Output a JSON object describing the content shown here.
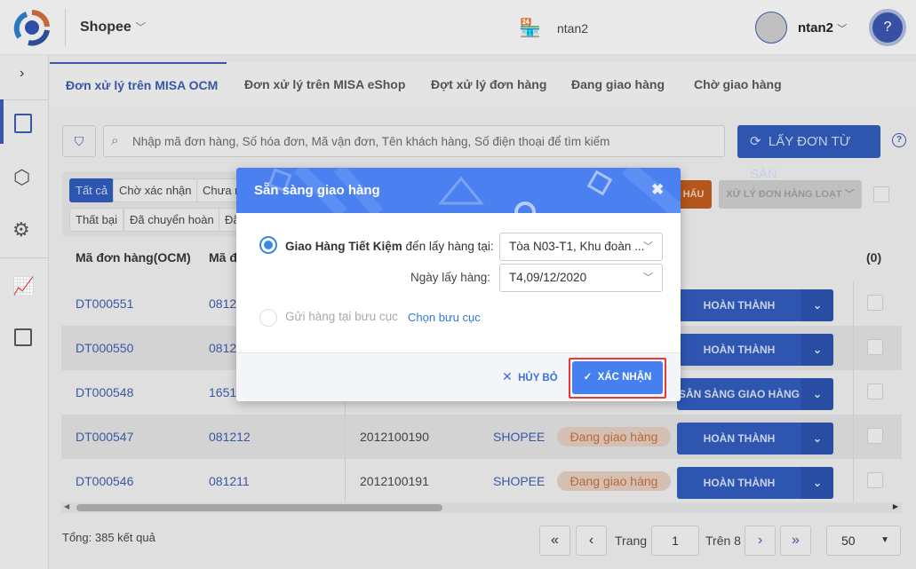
{
  "header": {
    "store": "Shopee",
    "shop_name": "ntan2",
    "user_name": "ntan2"
  },
  "tabs": [
    "Đơn xử lý trên MISA OCM",
    "Đơn xử lý trên MISA eShop",
    "Đợt xử lý đơn hàng",
    "Đang giao hàng",
    "Chờ giao hàng"
  ],
  "search": {
    "placeholder": "Nhập mã đơn hàng, Số hóa đơn, Mã vận đơn, Tên khách hàng, Số điện thoại để tìm kiếm",
    "fetch_button": "LẤY ĐƠN TỪ SÀN"
  },
  "chips": [
    "Tất cả",
    "Chờ xác nhận",
    "Chưa n",
    "Thất bại",
    "Đã chuyển hoàn",
    "Đã"
  ],
  "toolbar": {
    "orange_button": "HẤU",
    "bulk_button": "XỬ LÝ ĐƠN HÀNG LOẠT"
  },
  "table": {
    "headers": [
      "Mã đơn hàng(OCM)",
      "Mã đ",
      "(0)"
    ],
    "rows": [
      {
        "ocm": "DT000551",
        "code": "0812",
        "invoice": "",
        "channel": "",
        "status": "",
        "action": "HOÀN THÀNH"
      },
      {
        "ocm": "DT000550",
        "code": "0812",
        "invoice": "",
        "channel": "",
        "status": "",
        "action": "HOÀN THÀNH"
      },
      {
        "ocm": "DT000548",
        "code": "1651",
        "invoice": "",
        "channel": "",
        "status": "",
        "action": "SẴN SÀNG GIAO HÀNG"
      },
      {
        "ocm": "DT000547",
        "code": "081212",
        "invoice": "2012100190",
        "channel": "SHOPEEj",
        "status": "Đang giao hàng",
        "action": "HOÀN THÀNH"
      },
      {
        "ocm": "DT000546",
        "code": "081211",
        "invoice": "2012100191",
        "channel": "SHOPEE(",
        "status": "Đang giao hàng",
        "action": "HOÀN THÀNH"
      }
    ]
  },
  "footer": {
    "total": "Tổng: 385 kết quả",
    "page_label": "Trang",
    "page": "1",
    "of": "Trên 8",
    "page_size": "50"
  },
  "dialog": {
    "title": "Sẵn sàng giao hàng",
    "carrier": "Giao Hàng Tiết Kiệm",
    "carrier_suffix": "đến lấy hàng tại:",
    "address": "Tòa N03-T1, Khu đoàn ...",
    "date_label": "Ngày lấy hàng:",
    "date": "T4,09/12/2020",
    "post_office_option": "Gửi hàng tại bưu cục",
    "choose_post_office": "Chọn bưu cục",
    "cancel": "HỦY BỎ",
    "confirm": "XÁC NHẬN"
  }
}
